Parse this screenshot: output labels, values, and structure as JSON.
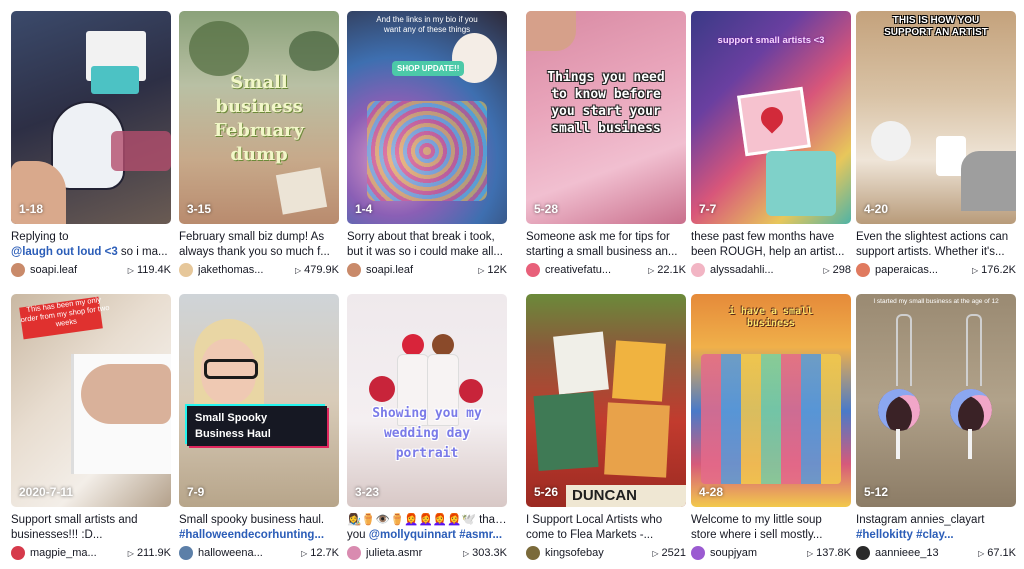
{
  "grid_left": {
    "cards": [
      {
        "date": "1-18",
        "caption1": "Replying to",
        "caption2_tag": "@laugh out loud <3",
        "caption2_rest": " so i ma...",
        "user": "soapi.leaf",
        "views": "119.4K",
        "avatar_color": "#c98a6a"
      },
      {
        "date": "3-15",
        "caption1": "February small biz dump! As",
        "caption2": "always thank you so much f...",
        "user": "jakethomas...",
        "views": "479.9K",
        "avatar_color": "#e6c79a",
        "overlay": "Small business February dump"
      },
      {
        "date": "1-4",
        "caption1": "Sorry about that break i took,",
        "caption2": "but it was so i could make all...",
        "user": "soapi.leaf",
        "views": "12K",
        "avatar_color": "#c98a6a",
        "overlay": "And the links in my bio if you want any of these things",
        "pill": "SHOP UPDATE!!"
      },
      {
        "date": "2020-7-11",
        "caption1": "Support small artists and",
        "caption2": "businesses!!! :D...",
        "user": "magpie_ma...",
        "views": "211.9K",
        "avatar_color": "#d63a4b",
        "overlay": "This has been my only order from my shop for two weeks"
      },
      {
        "date": "7-9",
        "caption1": "Small spooky business haul.",
        "caption2_tag": "#halloweendecorhunting...",
        "user": "halloweena...",
        "views": "12.7K",
        "avatar_color": "#5c7fa8",
        "overlay": "Small Spooky Business Haul"
      },
      {
        "date": "3-23",
        "caption1_emoji": "👩‍🎨⚱️👁️⚱️👩‍🦰👩‍🦰👩‍🦰👩‍🦰🕊️",
        "caption1_rest": " thank",
        "caption2_pre": "you ",
        "caption2_tag": "@mollyquinnart #asmr...",
        "user": "julieta.asmr",
        "views": "303.3K",
        "avatar_color": "#d98bb0",
        "overlay": "Showing you my wedding day portrait"
      }
    ]
  },
  "grid_right": {
    "cards": [
      {
        "date": "5-28",
        "caption1": "Someone ask me for tips for",
        "caption2": "starting a small business an...",
        "user": "creativefatu...",
        "views": "22.1K",
        "avatar_color": "#e8607a",
        "overlay": "Things you need to know before you start your small business"
      },
      {
        "date": "7-7",
        "caption1": "these past few months have",
        "caption2": "been ROUGH, help an artist...",
        "user": "alyssadahli...",
        "views": "298",
        "avatar_color": "#f2b5c4",
        "overlay": "support small artists <3"
      },
      {
        "date": "4-20",
        "caption1": "Even the slightest actions can",
        "caption2": "support artists. Whether it's...",
        "user": "paperaicas...",
        "views": "176.2K",
        "avatar_color": "#e07a5f",
        "overlay": "THIS IS HOW YOU SUPPORT AN ARTIST"
      },
      {
        "date": "5-26",
        "caption1": "I Support Local Artists who",
        "caption2": "come to Flea Markets -...",
        "user": "kingsofebay",
        "views": "2521",
        "avatar_color": "#7a6a3a",
        "overlay": "DUNCAN"
      },
      {
        "date": "4-28",
        "caption1": "Welcome to my little soup",
        "caption2": "store where i sell mostly...",
        "user": "soupjyam",
        "views": "137.8K",
        "avatar_color": "#9b5bd1",
        "overlay": "i have a small business"
      },
      {
        "date": "5-12",
        "caption1": "Instagram annies_clayart",
        "caption2_tag": "#hellokitty #clay...",
        "user": "aannieee_13",
        "views": "67.1K",
        "avatar_color": "#2a2a2a",
        "overlay": "I started my small business at the age of 12"
      }
    ]
  }
}
